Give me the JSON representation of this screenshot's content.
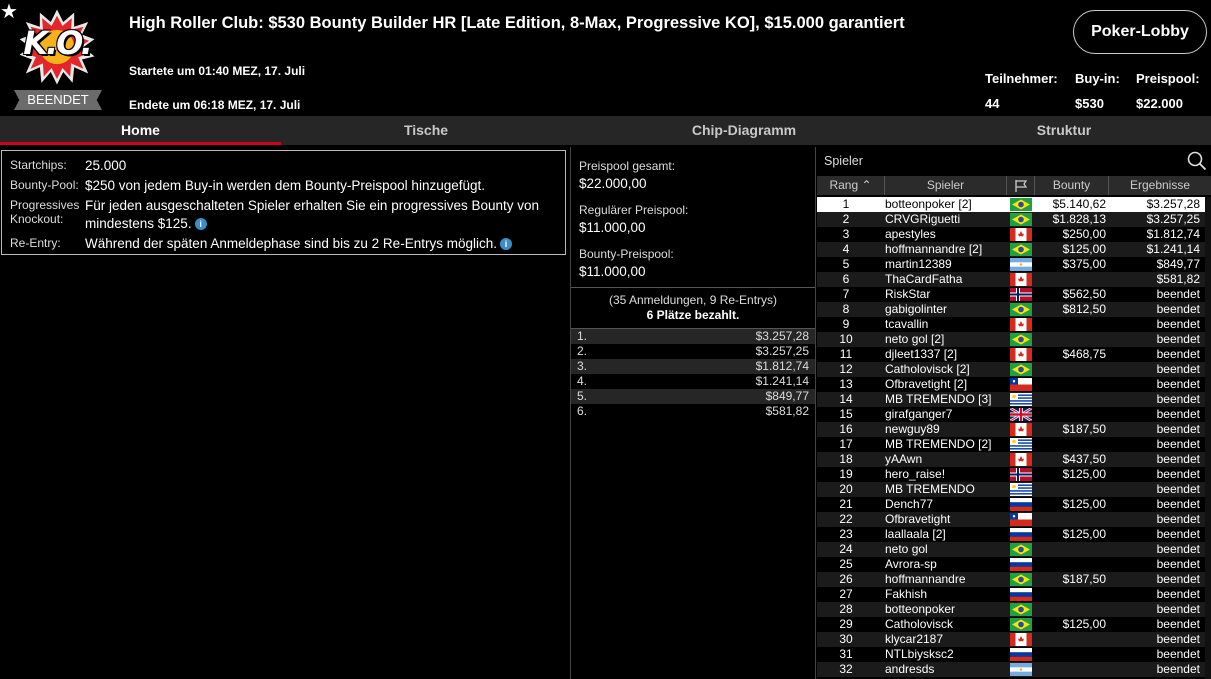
{
  "header": {
    "title": "High Roller Club: $530 Bounty Builder HR [Late Edition, 8-Max, Progressive KO], $15.000 garantiert",
    "logo_text": "K.O.",
    "status_badge": "BEENDET",
    "started": "Startete um 01:40 MEZ, 17. Juli",
    "ended": "Endete um 06:18 MEZ, 17. Juli",
    "lobby_button": "Poker-Lobby",
    "stats": [
      {
        "label": "Teilnehmer:",
        "value": "44"
      },
      {
        "label": "Buy-in:",
        "value": "$530"
      },
      {
        "label": "Preispool:",
        "value": "$22.000"
      }
    ]
  },
  "tabs": [
    "Home",
    "Tische",
    "Chip-Diagramm",
    "Struktur"
  ],
  "info": {
    "startchips_label": "Startchips:",
    "startchips_value": "25.000",
    "bounty_pool_label": "Bounty-Pool:",
    "bounty_pool_value": "$250 von jedem Buy-in werden dem Bounty-Preispool hinzugefügt.",
    "pko_label_1": "Progressives",
    "pko_label_2": "Knockout:",
    "pko_value": "Für jeden ausgeschalteten Spieler erhalten Sie ein progressives Bounty von mindestens $125.",
    "reentry_label": "Re-Entry:",
    "reentry_value": "Während der späten Anmeldephase sind bis zu 2 Re-Entrys möglich."
  },
  "pool": {
    "total_label": "Preispool gesamt:",
    "total_value": "$22.000,00",
    "regular_label": "Regulärer Preispool:",
    "regular_value": "$11.000,00",
    "bounty_label": "Bounty-Preispool:",
    "bounty_value": "$11.000,00",
    "registrations": "(35 Anmeldungen, 9 Re-Entrys)",
    "paid_places": "6 Plätze bezahlt.",
    "prizes": [
      {
        "place": "1.",
        "amount": "$3.257,28"
      },
      {
        "place": "2.",
        "amount": "$3.257,25"
      },
      {
        "place": "3.",
        "amount": "$1.812,74"
      },
      {
        "place": "4.",
        "amount": "$1.241,14"
      },
      {
        "place": "5.",
        "amount": "$849,77"
      },
      {
        "place": "6.",
        "amount": "$581,82"
      }
    ]
  },
  "players": {
    "search_label": "Spieler",
    "columns": {
      "rank": "Rang",
      "player": "Spieler",
      "bounty": "Bounty",
      "result": "Ergebnisse"
    },
    "rows": [
      {
        "rank": "1",
        "name": "botteonpoker [2]",
        "flag": "br",
        "bounty": "$5.140,62",
        "result": "$3.257,28"
      },
      {
        "rank": "2",
        "name": "CRVGRiguetti",
        "flag": "br",
        "bounty": "$1.828,13",
        "result": "$3.257,25"
      },
      {
        "rank": "3",
        "name": "apestyles",
        "flag": "ca",
        "bounty": "$250,00",
        "result": "$1.812,74"
      },
      {
        "rank": "4",
        "name": "hoffmannandre [2]",
        "flag": "br",
        "bounty": "$125,00",
        "result": "$1.241,14"
      },
      {
        "rank": "5",
        "name": "martin12389",
        "flag": "ar",
        "bounty": "$375,00",
        "result": "$849,77"
      },
      {
        "rank": "6",
        "name": "ThaCardFatha",
        "flag": "ca",
        "bounty": "",
        "result": "$581,82"
      },
      {
        "rank": "7",
        "name": "RiskStar",
        "flag": "no",
        "bounty": "$562,50",
        "result": "beendet"
      },
      {
        "rank": "8",
        "name": "gabigolinter",
        "flag": "br",
        "bounty": "$812,50",
        "result": "beendet"
      },
      {
        "rank": "9",
        "name": "tcavallin",
        "flag": "ca",
        "bounty": "",
        "result": "beendet"
      },
      {
        "rank": "10",
        "name": "neto gol [2]",
        "flag": "br",
        "bounty": "",
        "result": "beendet"
      },
      {
        "rank": "11",
        "name": "djleet1337 [2]",
        "flag": "ca",
        "bounty": "$468,75",
        "result": "beendet"
      },
      {
        "rank": "12",
        "name": "Catholovisck [2]",
        "flag": "br",
        "bounty": "",
        "result": "beendet"
      },
      {
        "rank": "13",
        "name": "Ofbravetight [2]",
        "flag": "cl",
        "bounty": "",
        "result": "beendet"
      },
      {
        "rank": "14",
        "name": "MB TREMENDO [3]",
        "flag": "uy",
        "bounty": "",
        "result": "beendet"
      },
      {
        "rank": "15",
        "name": "girafganger7",
        "flag": "gb",
        "bounty": "",
        "result": "beendet"
      },
      {
        "rank": "16",
        "name": "newguy89",
        "flag": "ca",
        "bounty": "$187,50",
        "result": "beendet"
      },
      {
        "rank": "17",
        "name": "MB TREMENDO [2]",
        "flag": "uy",
        "bounty": "",
        "result": "beendet"
      },
      {
        "rank": "18",
        "name": "yAAwn",
        "flag": "ca",
        "bounty": "$437,50",
        "result": "beendet"
      },
      {
        "rank": "19",
        "name": "hero_raise!",
        "flag": "no",
        "bounty": "$125,00",
        "result": "beendet"
      },
      {
        "rank": "20",
        "name": "MB TREMENDO",
        "flag": "uy",
        "bounty": "",
        "result": "beendet"
      },
      {
        "rank": "21",
        "name": "Dench77",
        "flag": "ru",
        "bounty": "$125,00",
        "result": "beendet"
      },
      {
        "rank": "22",
        "name": "Ofbravetight",
        "flag": "cl",
        "bounty": "",
        "result": "beendet"
      },
      {
        "rank": "23",
        "name": "laallaala [2]",
        "flag": "ru",
        "bounty": "$125,00",
        "result": "beendet"
      },
      {
        "rank": "24",
        "name": "neto gol",
        "flag": "br",
        "bounty": "",
        "result": "beendet"
      },
      {
        "rank": "25",
        "name": "Avrora-sp",
        "flag": "ru",
        "bounty": "",
        "result": "beendet"
      },
      {
        "rank": "26",
        "name": "hoffmannandre",
        "flag": "br",
        "bounty": "$187,50",
        "result": "beendet"
      },
      {
        "rank": "27",
        "name": "Fakhish",
        "flag": "ru",
        "bounty": "",
        "result": "beendet"
      },
      {
        "rank": "28",
        "name": "botteonpoker",
        "flag": "br",
        "bounty": "",
        "result": "beendet"
      },
      {
        "rank": "29",
        "name": "Catholovisck",
        "flag": "br",
        "bounty": "$125,00",
        "result": "beendet"
      },
      {
        "rank": "30",
        "name": "klycar2187",
        "flag": "ca",
        "bounty": "",
        "result": "beendet"
      },
      {
        "rank": "31",
        "name": "NTLbiysksc2",
        "flag": "ru",
        "bounty": "",
        "result": "beendet"
      },
      {
        "rank": "32",
        "name": "andresds",
        "flag": "ar",
        "bounty": "",
        "result": "beendet"
      }
    ]
  },
  "colors": {
    "accent_red": "#d0021b",
    "info_blue": "#3a8ec8",
    "selected_row": "#ffffff"
  }
}
